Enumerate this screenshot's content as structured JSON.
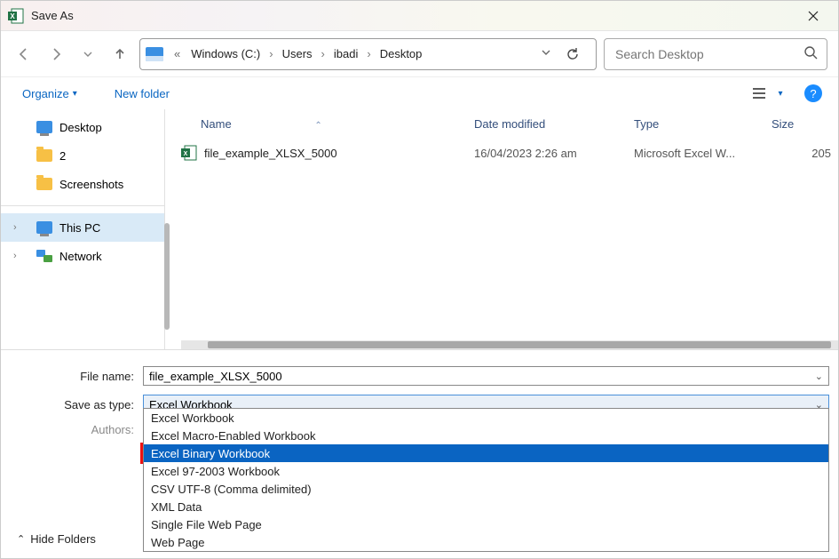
{
  "window": {
    "title": "Save As"
  },
  "breadcrumb": {
    "drive": "Windows (C:)",
    "p1": "Users",
    "p2": "ibadi",
    "p3": "Desktop"
  },
  "search": {
    "placeholder": "Search Desktop"
  },
  "toolbar": {
    "organize": "Organize",
    "new_folder": "New folder"
  },
  "sidebar": {
    "desktop": "Desktop",
    "two": "2",
    "screenshots": "Screenshots",
    "this_pc": "This PC",
    "network": "Network"
  },
  "columns": {
    "name": "Name",
    "date": "Date modified",
    "type": "Type",
    "size": "Size"
  },
  "files": [
    {
      "name": "file_example_XLSX_5000",
      "date": "16/04/2023 2:26 am",
      "type": "Microsoft Excel W...",
      "size": "205"
    }
  ],
  "form": {
    "filename_label": "File name:",
    "filename_value": "file_example_XLSX_5000",
    "saveas_label": "Save as type:",
    "saveas_value": "Excel Workbook",
    "authors_label": "Authors:"
  },
  "dropdown": {
    "options": [
      "Excel Workbook",
      "Excel Macro-Enabled Workbook",
      "Excel Binary Workbook",
      "Excel 97-2003 Workbook",
      "CSV UTF-8 (Comma delimited)",
      "XML Data",
      "Single File Web Page",
      "Web Page"
    ],
    "highlight_index": 2
  },
  "footer": {
    "hide_folders": "Hide Folders"
  }
}
